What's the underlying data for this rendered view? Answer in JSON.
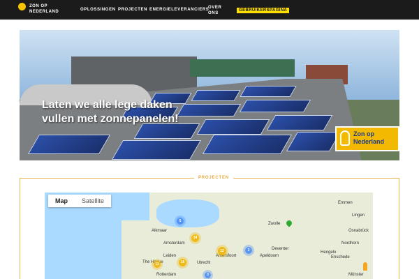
{
  "header": {
    "logo_text": "ZON OP NEDERLAND",
    "nav": [
      "OPLOSSINGEN",
      "PROJECTEN",
      "ENERGIELEVERANCIERS",
      "OVER ONS"
    ],
    "user_button": "GEBRUIKERSPAGINA"
  },
  "hero": {
    "headline": "Laten we alle lege daken vullen met zonnepanelen!",
    "logo_text": "Zon op Nederland"
  },
  "projects": {
    "title": "PROJECTEN",
    "map_tabs": [
      "Map",
      "Satellite"
    ],
    "cities": [
      "Alkmaar",
      "Amsterdam",
      "Leiden",
      "The Hague",
      "Rotterdam",
      "Utrecht",
      "Amersfoort",
      "Apeldoorn",
      "Deventer",
      "Zwolle",
      "Enschede",
      "Hengelo",
      "Nordhorn",
      "Osnabrück",
      "Münster",
      "Emmen",
      "Lingen"
    ],
    "clusters": [
      {
        "value": "5",
        "color": "blue"
      },
      {
        "value": "34",
        "color": "yellow"
      },
      {
        "value": "12",
        "color": "yellow"
      },
      {
        "value": "3",
        "color": "blue"
      },
      {
        "value": "11",
        "color": "yellow"
      },
      {
        "value": "16",
        "color": "yellow"
      },
      {
        "value": "3",
        "color": "blue"
      }
    ]
  },
  "colors": {
    "accent": "#f5c400",
    "section_border": "#e6b450",
    "topbar": "#1b1b1b"
  }
}
